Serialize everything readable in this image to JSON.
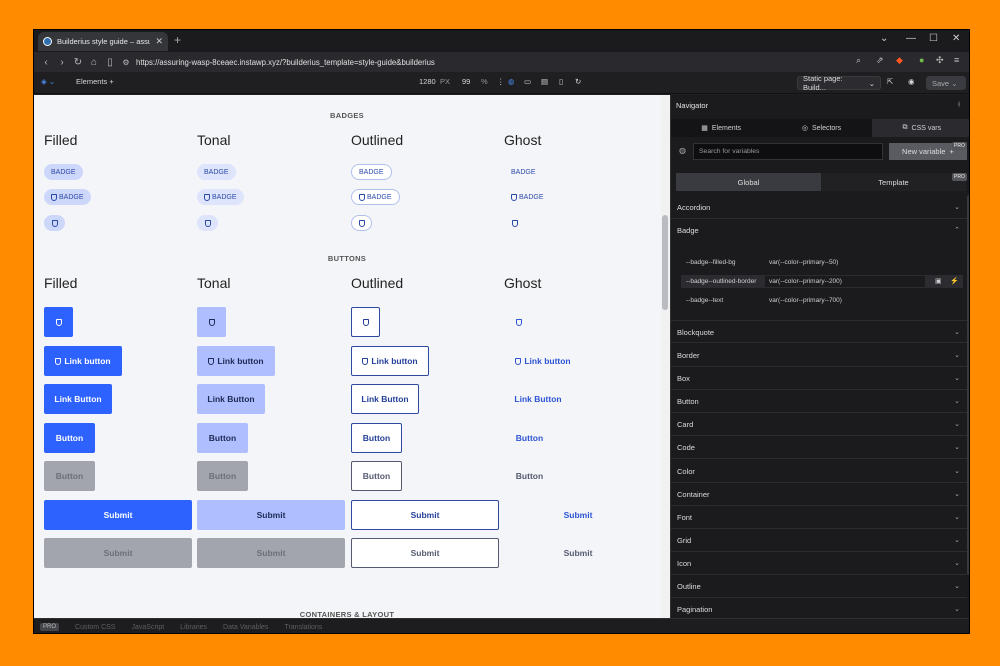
{
  "browser": {
    "tab_title": "Builderius style guide – assuring",
    "url": "https://assuring-wasp-8ceaec.instawp.xyz/?builderius_template=style-guide&builderius"
  },
  "toolbar": {
    "elements_label": "Elements",
    "width_value": "1280",
    "width_unit": "PX",
    "zoom_value": "99",
    "zoom_unit": "%",
    "page_select": "Static page: Build...",
    "save_label": "Save"
  },
  "canvas": {
    "badges_heading": "BADGES",
    "buttons_heading": "BUTTONS",
    "containers_heading": "CONTAINERS & LAYOUT",
    "columns": [
      "Filled",
      "Tonal",
      "Outlined",
      "Ghost"
    ],
    "badge_label": "BADGE",
    "link_button": "Link button",
    "link_button_alt": "Link Button",
    "button_label": "Button",
    "submit_label": "Submit"
  },
  "navigator": {
    "title": "Navigator",
    "tabs": [
      "Elements",
      "Selectors",
      "CSS vars"
    ],
    "search_placeholder": "Search for variables",
    "new_variable": "New variable",
    "pro": "PRO",
    "scope_global": "Global",
    "scope_template": "Template",
    "sections": [
      "Accordion",
      "Badge",
      "Blockquote",
      "Border",
      "Box",
      "Button",
      "Card",
      "Code",
      "Color",
      "Container",
      "Font",
      "Grid",
      "Icon",
      "Outline",
      "Pagination"
    ],
    "badge_vars": [
      {
        "name": "--badge--filled-bg",
        "value": "var(--color--primary--50)"
      },
      {
        "name": "--badge--outlined-border",
        "value": "var(--color--primary--200)"
      },
      {
        "name": "--badge--text",
        "value": "var(--color--primary--700)"
      }
    ]
  },
  "footer": {
    "pro": "PRO",
    "items": [
      "Custom CSS",
      "JavaScript",
      "Libraries",
      "Data Variables",
      "Translations"
    ]
  },
  "colors": {
    "accent": "#2d62ff",
    "frame": "#ff8c00"
  }
}
